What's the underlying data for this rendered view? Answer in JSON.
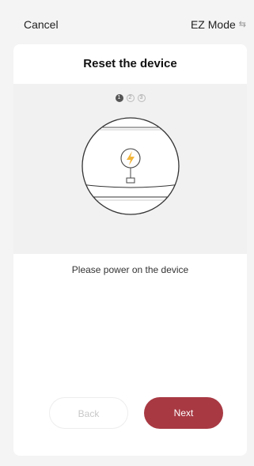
{
  "header": {
    "cancel_label": "Cancel",
    "mode_label": "EZ Mode",
    "mode_icon": "swap-icon"
  },
  "card": {
    "title": "Reset the device",
    "steps": [
      {
        "label": "1",
        "active": true
      },
      {
        "label": "2",
        "active": false
      },
      {
        "label": "3",
        "active": false
      }
    ],
    "illustration": {
      "icon": "lightning-bolt-icon",
      "accent_color": "#f2b53a"
    },
    "message": "Please power on the device"
  },
  "buttons": {
    "back_label": "Back",
    "next_label": "Next",
    "next_color": "#a83943"
  }
}
